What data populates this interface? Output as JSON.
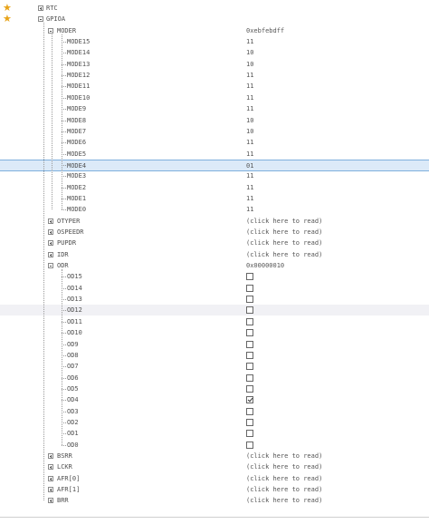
{
  "tree": {
    "favorites": [
      "RTC",
      "GPIOA"
    ],
    "peripherals": [
      {
        "label": "RTC",
        "expanded": false,
        "starred": true
      },
      {
        "label": "GPIOA",
        "expanded": true,
        "starred": true
      }
    ],
    "registers": [
      {
        "label": "MODER",
        "expanded": true,
        "value": "0xebfebdff",
        "fields": [
          {
            "label": "MODE15",
            "value": "11"
          },
          {
            "label": "MODE14",
            "value": "10"
          },
          {
            "label": "MODE13",
            "value": "10"
          },
          {
            "label": "MODE12",
            "value": "11"
          },
          {
            "label": "MODE11",
            "value": "11"
          },
          {
            "label": "MODE10",
            "value": "11"
          },
          {
            "label": "MODE9",
            "value": "11"
          },
          {
            "label": "MODE8",
            "value": "10"
          },
          {
            "label": "MODE7",
            "value": "10"
          },
          {
            "label": "MODE6",
            "value": "11"
          },
          {
            "label": "MODE5",
            "value": "11"
          },
          {
            "label": "MODE4",
            "value": "01",
            "selected": true
          },
          {
            "label": "MODE3",
            "value": "11"
          },
          {
            "label": "MODE2",
            "value": "11"
          },
          {
            "label": "MODE1",
            "value": "11"
          },
          {
            "label": "MODE0",
            "value": "11"
          }
        ]
      },
      {
        "label": "OTYPER",
        "expanded": false,
        "value": "(click here to read)"
      },
      {
        "label": "OSPEEDR",
        "expanded": false,
        "value": "(click here to read)"
      },
      {
        "label": "PUPDR",
        "expanded": false,
        "value": "(click here to read)"
      },
      {
        "label": "IDR",
        "expanded": false,
        "value": "(click here to read)"
      },
      {
        "label": "ODR",
        "expanded": true,
        "value": "0x00000010",
        "fields": [
          {
            "label": "OD15",
            "checked": false
          },
          {
            "label": "OD14",
            "checked": false
          },
          {
            "label": "OD13",
            "checked": false
          },
          {
            "label": "OD12",
            "checked": false,
            "hover": true
          },
          {
            "label": "OD11",
            "checked": false
          },
          {
            "label": "OD10",
            "checked": false
          },
          {
            "label": "OD9",
            "checked": false
          },
          {
            "label": "OD8",
            "checked": false
          },
          {
            "label": "OD7",
            "checked": false
          },
          {
            "label": "OD6",
            "checked": false
          },
          {
            "label": "OD5",
            "checked": false
          },
          {
            "label": "OD4",
            "checked": true
          },
          {
            "label": "OD3",
            "checked": false
          },
          {
            "label": "OD2",
            "checked": false
          },
          {
            "label": "OD1",
            "checked": false
          },
          {
            "label": "OD0",
            "checked": false
          }
        ]
      },
      {
        "label": "BSRR",
        "expanded": false,
        "value": "(click here to read)"
      },
      {
        "label": "LCKR",
        "expanded": false,
        "value": "(click here to read)"
      },
      {
        "label": "AFR[0]",
        "expanded": false,
        "value": "(click here to read)"
      },
      {
        "label": "AFR[1]",
        "expanded": false,
        "value": "(click here to read)"
      },
      {
        "label": "BRR",
        "expanded": false,
        "value": "(click here to read)"
      }
    ]
  },
  "colors": {
    "star": "#e8a317",
    "selection": "#dceaf8",
    "selection_border": "#7fb0dd"
  }
}
